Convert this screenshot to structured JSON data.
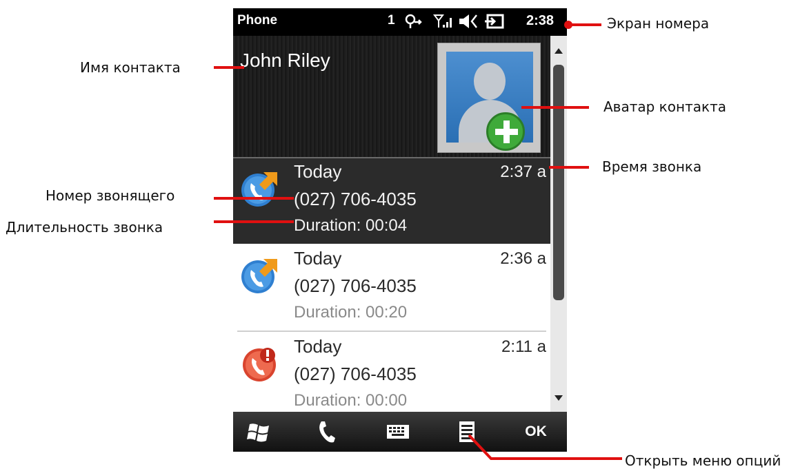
{
  "status_bar": {
    "title": "Phone",
    "indicator_count": "1",
    "time": "2:38"
  },
  "contact": {
    "name": "John Riley"
  },
  "calls": [
    {
      "day": "Today",
      "time": "2:37 a",
      "number": "(027) 706-4035",
      "duration": "Duration: 00:04",
      "icon": "outgoing-call-icon",
      "selected": true
    },
    {
      "day": "Today",
      "time": "2:36 a",
      "number": "(027) 706-4035",
      "duration": "Duration: 00:20",
      "icon": "outgoing-call-icon",
      "selected": false
    },
    {
      "day": "Today",
      "time": "2:11 a",
      "number": "(027) 706-4035",
      "duration": "Duration: 00:00",
      "icon": "missed-call-icon",
      "selected": false
    }
  ],
  "toolbar": {
    "ok_label": "OK",
    "icons": [
      "windows-start-icon",
      "phone-icon",
      "keyboard-icon",
      "menu-icon"
    ]
  },
  "annotations": {
    "screen": "Экран номера",
    "contact_name": "Имя контакта",
    "contact_avatar": "Аватар контакта",
    "call_time": "Время звонка",
    "caller_number": "Номер звонящего",
    "call_duration": "Длительность звонка",
    "open_menu": "Открыть меню опций"
  },
  "colors": {
    "annotation_lead": "#e01010",
    "selected_row": "#2b2b2b",
    "avatar_plus": "#3faa3a",
    "outgoing_icon": "#2f7fd0",
    "missed_icon": "#d9442e"
  }
}
